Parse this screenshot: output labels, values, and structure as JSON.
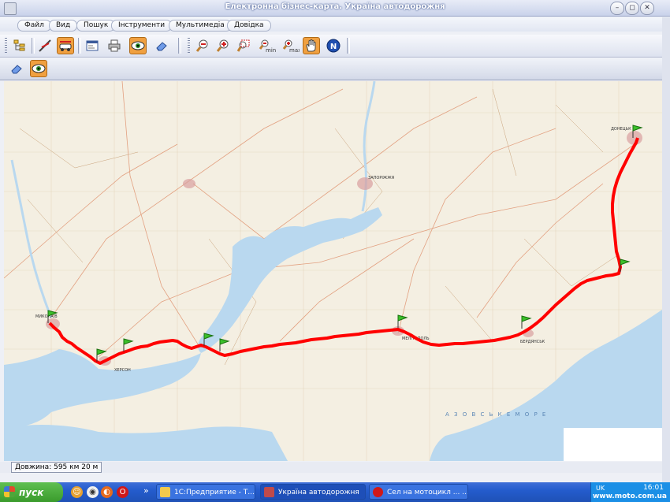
{
  "window": {
    "title": "Електронна бізнес-карта. Україна автодорожня"
  },
  "menu": [
    "Файл",
    "Вид",
    "Пошук",
    "Інструменти",
    "Мультимедіа",
    "Довідка"
  ],
  "toolbar": {
    "zoom_min": "min",
    "zoom_max": "max",
    "north": "N"
  },
  "map": {
    "water_color": "#b9d8ef",
    "land_color": "#f4efe2",
    "route_color": "#ff0000",
    "sea_label": "А З О В С Ь К Е   М О Р Е",
    "cities": [
      "МИКОЛАЇВ",
      "ХЕРСОН",
      "ЗАПОРІЖЖЯ",
      "МЕЛІТОПОЛЬ",
      "БЕРДЯНСЬК",
      "ДОНЕЦЬК"
    ]
  },
  "status": {
    "length": "Довжина: 595 км 20 м"
  },
  "taskbar": {
    "start": "пуск",
    "tasks": [
      "1С:Предприятие - Т...",
      "Україна автодорожня",
      "Сел на мотоцикл ... ..."
    ],
    "lang": "UK",
    "clock": "16:01",
    "watermark": "www.moto.com.ua"
  }
}
